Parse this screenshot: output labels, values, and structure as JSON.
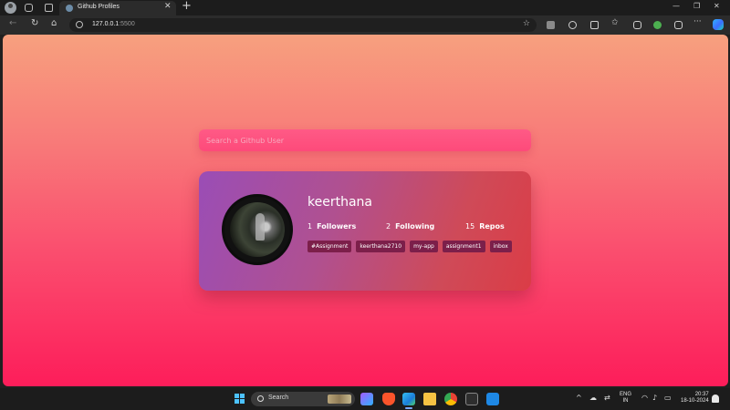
{
  "browser": {
    "tab": {
      "title": "Github Profiles"
    },
    "address": {
      "host": "127.0.0.1",
      "port": ":5500"
    }
  },
  "page": {
    "search": {
      "placeholder": "Search a Github User"
    },
    "profile": {
      "username": "keerthana",
      "followers": {
        "count": "1",
        "label": "Followers"
      },
      "following": {
        "count": "2",
        "label": "Following"
      },
      "repos": {
        "count": "15",
        "label": "Repos"
      },
      "repo_tags": [
        "#Assignment",
        "keerthana2710",
        "my-app",
        "assignment1",
        "inbox"
      ]
    }
  },
  "taskbar": {
    "search_label": "Search",
    "language": {
      "line1": "ENG",
      "line2": "IN"
    },
    "clock": {
      "time": "20:37",
      "date": "18-10-2024"
    }
  },
  "colors": {
    "bg_top": "#f7a07e",
    "bg_bottom": "#fd1d5a",
    "tag_bg": "#7c1f4a"
  }
}
